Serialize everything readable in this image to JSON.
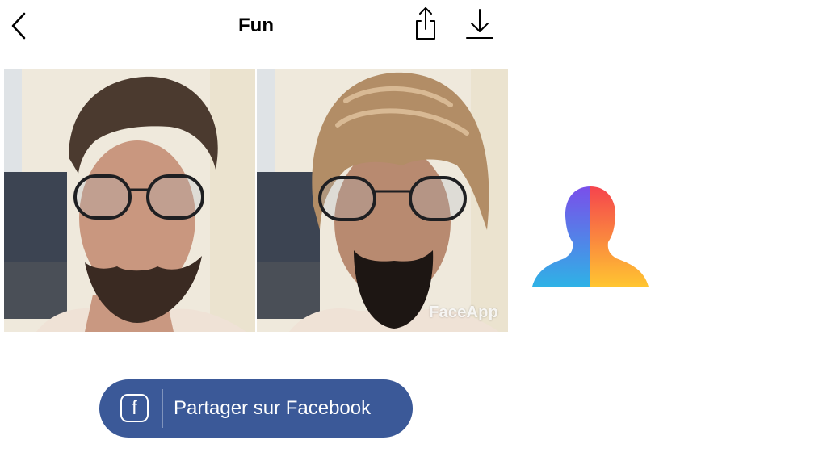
{
  "header": {
    "title": "Fun",
    "back_icon": "chevron-left-icon",
    "share_icon": "share-icon",
    "download_icon": "download-icon"
  },
  "photos": {
    "watermark": "FaceApp"
  },
  "logo": {
    "icon": "faceapp-head-logo",
    "colors": [
      "#7b4dea",
      "#2fa4ea",
      "#f5424e",
      "#ffc531"
    ]
  },
  "facebook": {
    "icon_letter": "f",
    "label": "Partager sur Facebook",
    "color": "#3b5998"
  }
}
